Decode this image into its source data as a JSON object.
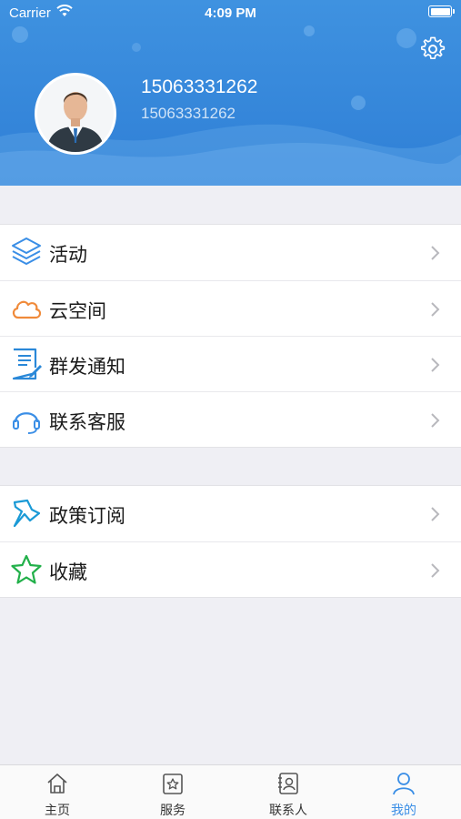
{
  "status": {
    "carrier": "Carrier",
    "time": "4:09 PM"
  },
  "profile": {
    "name": "15063331262",
    "subtitle": "15063331262"
  },
  "menu_group_1": [
    {
      "label": "活动",
      "icon": "layers-icon"
    },
    {
      "label": "云空间",
      "icon": "cloud-icon"
    },
    {
      "label": "群发通知",
      "icon": "document-edit-icon"
    },
    {
      "label": "联系客服",
      "icon": "headset-icon"
    }
  ],
  "menu_group_2": [
    {
      "label": "政策订阅",
      "icon": "pin-icon"
    },
    {
      "label": "收藏",
      "icon": "star-icon"
    }
  ],
  "tabs": [
    {
      "label": "主页",
      "icon": "home-icon"
    },
    {
      "label": "服务",
      "icon": "service-icon"
    },
    {
      "label": "联系人",
      "icon": "contacts-icon"
    },
    {
      "label": "我的",
      "icon": "person-icon",
      "active": true
    }
  ],
  "colors": {
    "header": "#3a8ee6",
    "accent": "#3a8ee6",
    "background": "#efeff4"
  }
}
